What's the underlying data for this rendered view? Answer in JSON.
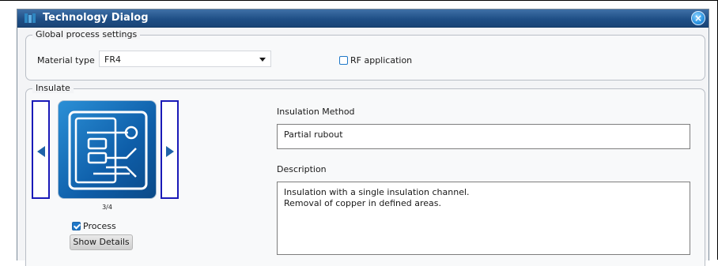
{
  "window": {
    "title": "Technology Dialog",
    "close_glyph": "×"
  },
  "global_settings": {
    "legend": "Global process settings",
    "material_label": "Material type",
    "material_value": "FR4",
    "rf_label": "RF application",
    "rf_checked": false
  },
  "insulate": {
    "legend": "Insulate",
    "counter": "3/4",
    "process_label": "Process",
    "process_checked": true,
    "show_details_label": "Show Details",
    "method_label": "Insulation Method",
    "method_value": "Partial rubout",
    "description_label": "Description",
    "description_lines": [
      "Insulation with a single insulation channel.",
      "Removal of copper in defined areas."
    ]
  },
  "colors": {
    "title_bar": "#1f4f86",
    "accent": "#1f78c8",
    "nav_border": "#1a1ab8"
  },
  "icons": {
    "app": "app-logo-icon",
    "close": "close-icon",
    "prev": "arrow-left-icon",
    "next": "arrow-right-icon"
  }
}
